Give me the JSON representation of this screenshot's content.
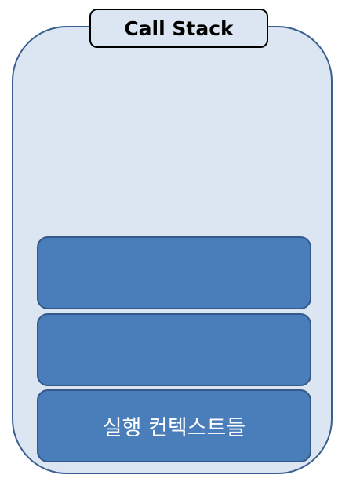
{
  "diagram": {
    "title": "Call Stack",
    "frames": [
      {
        "label": ""
      },
      {
        "label": ""
      },
      {
        "label": "실행 컨텍스트들"
      }
    ]
  },
  "colors": {
    "container_fill": "#dce6f2",
    "container_border": "#3a5f8f",
    "frame_fill": "#4a7ebb",
    "frame_border": "#34598a",
    "title_border": "#000000",
    "frame_text": "#ffffff"
  }
}
